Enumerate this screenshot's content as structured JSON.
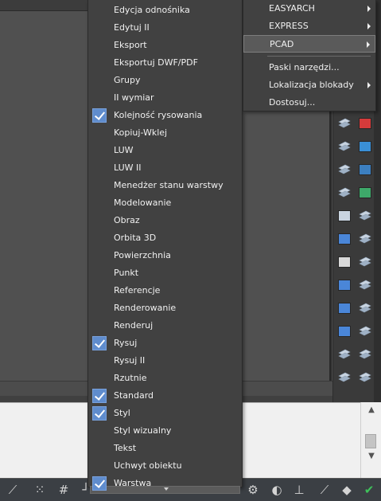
{
  "context_menu": {
    "items": [
      {
        "label": "Edycja odnośnika",
        "checked": false
      },
      {
        "label": "Edytuj II",
        "checked": false
      },
      {
        "label": "Eksport",
        "checked": false
      },
      {
        "label": "Eksportuj DWF/PDF",
        "checked": false
      },
      {
        "label": "Grupy",
        "checked": false
      },
      {
        "label": "II wymiar",
        "checked": false
      },
      {
        "label": "Kolejność rysowania",
        "checked": true
      },
      {
        "label": "Kopiuj-Wklej",
        "checked": false
      },
      {
        "label": "LUW",
        "checked": false
      },
      {
        "label": "LUW II",
        "checked": false
      },
      {
        "label": "Menedżer stanu warstwy",
        "checked": false
      },
      {
        "label": "Modelowanie",
        "checked": false
      },
      {
        "label": "Obraz",
        "checked": false
      },
      {
        "label": "Orbita 3D",
        "checked": false
      },
      {
        "label": "Powierzchnia",
        "checked": false
      },
      {
        "label": "Punkt",
        "checked": false
      },
      {
        "label": "Referencje",
        "checked": false
      },
      {
        "label": "Renderowanie",
        "checked": false
      },
      {
        "label": "Renderuj",
        "checked": false
      },
      {
        "label": "Rysuj",
        "checked": true
      },
      {
        "label": "Rysuj II",
        "checked": false
      },
      {
        "label": "Rzutnie",
        "checked": false
      },
      {
        "label": "Standard",
        "checked": true
      },
      {
        "label": "Styl",
        "checked": true
      },
      {
        "label": "Styl wizualny",
        "checked": false
      },
      {
        "label": "Tekst",
        "checked": false
      },
      {
        "label": "Uchwyt obiektu",
        "checked": false
      },
      {
        "label": "Warstwa",
        "checked": true
      }
    ]
  },
  "submenu": {
    "items": [
      {
        "label": "EASYARCH",
        "has_submenu": true,
        "highlighted": false
      },
      {
        "label": "EXPRESS",
        "has_submenu": true,
        "highlighted": false
      },
      {
        "label": "PCAD",
        "has_submenu": true,
        "highlighted": true
      },
      {
        "label": "Paski narzędzi...",
        "has_submenu": false,
        "highlighted": false
      },
      {
        "label": "Lokalizacja blokady",
        "has_submenu": true,
        "highlighted": false
      },
      {
        "label": "Dostosuj...",
        "has_submenu": false,
        "highlighted": false
      }
    ]
  },
  "right_toolbar": {
    "icons": [
      "layer-icon",
      "pdf-icon",
      "layer-icon",
      "globe-icon",
      "layer-icon",
      "dwf-icon",
      "layer-icon",
      "refresh-icon",
      "filter-icon",
      "layer-icon",
      "block-icon",
      "layer-icon",
      "copy-icon",
      "layer-icon",
      "block-icon",
      "layer-icon",
      "block-icon",
      "layer-icon",
      "text-abc-icon",
      "layer-icon",
      "layer-icon",
      "layer-icon",
      "layer-icon",
      "layer-icon"
    ]
  },
  "status_bar": {
    "icons": [
      "snap-icon",
      "grid-dots-icon",
      "grid-icon",
      "ortho-icon",
      "gear-icon",
      "annotation-icon",
      "ucs-icon",
      "dynamic-input-icon",
      "object-snap-icon",
      "ok-icon"
    ]
  },
  "colors": {
    "menu_bg": "#414141",
    "check_bg": "#5f8ccd",
    "highlight_bg": "#5a5a5a"
  }
}
